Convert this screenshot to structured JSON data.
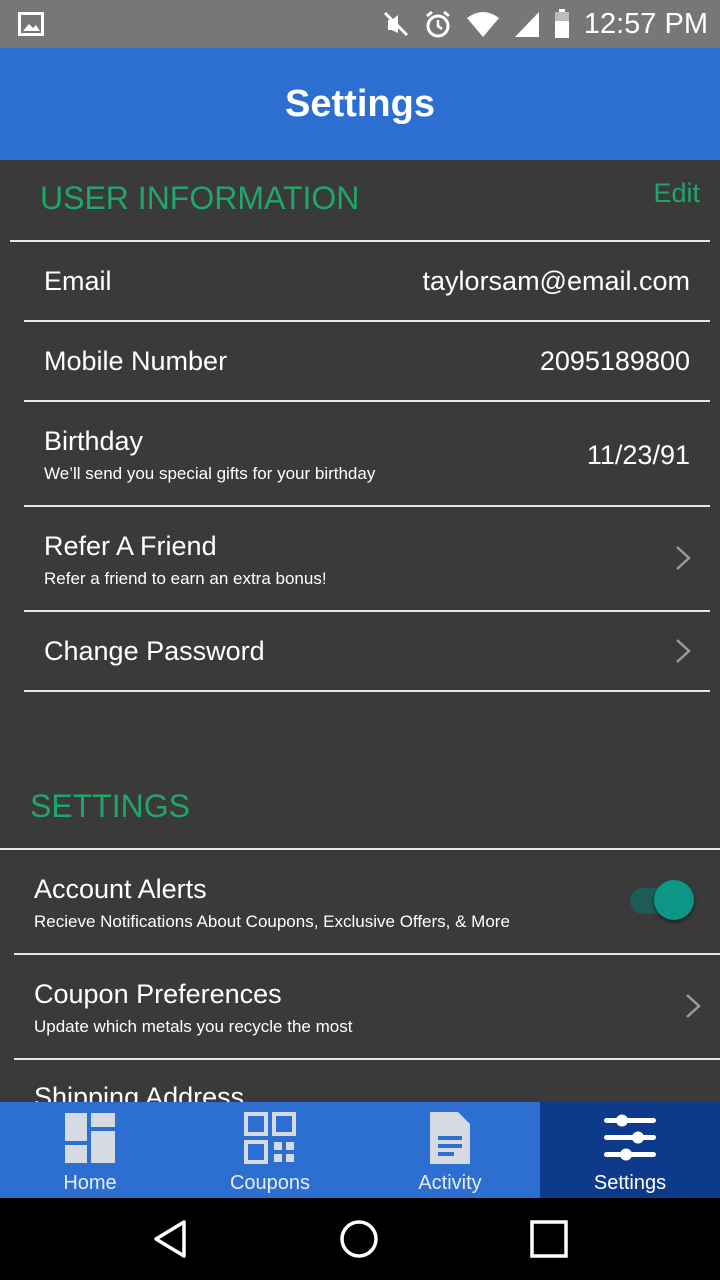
{
  "status_bar": {
    "time": "12:57 PM",
    "icons": [
      "image-icon",
      "mute-icon",
      "alarm-icon",
      "wifi-icon",
      "signal-icon",
      "battery-icon"
    ]
  },
  "app_bar": {
    "title": "Settings"
  },
  "user_info": {
    "header": "USER INFORMATION",
    "edit_label": "Edit",
    "rows": [
      {
        "label": "Email",
        "value": "taylorsam@email.com"
      },
      {
        "label": "Mobile Number",
        "value": "2095189800"
      },
      {
        "label": "Birthday",
        "sub": "We’ll send you special gifts for your birthday",
        "value": "11/23/91"
      },
      {
        "label": "Refer A Friend",
        "sub": "Refer a friend to earn an extra bonus!"
      },
      {
        "label": "Change Password"
      }
    ]
  },
  "settings": {
    "header": "SETTINGS",
    "rows": [
      {
        "label": "Account Alerts",
        "sub": "Recieve Notifications About Coupons, Exclusive Offers, & More",
        "toggle_on": true
      },
      {
        "label": "Coupon Preferences",
        "sub": "Update which metals you recycle the most"
      },
      {
        "label": "Shipping Address"
      }
    ]
  },
  "bottom_nav": {
    "items": [
      {
        "label": "Home",
        "icon": "dashboard-icon"
      },
      {
        "label": "Coupons",
        "icon": "qr-code-icon"
      },
      {
        "label": "Activity",
        "icon": "document-icon"
      },
      {
        "label": "Settings",
        "icon": "sliders-icon",
        "active": true
      }
    ]
  },
  "colors": {
    "accent_green": "#1fa66a",
    "app_bar_blue": "#2d6fd0",
    "nav_active": "#0d3a8a",
    "background": "#3a3a3a",
    "toggle_teal": "#0d9685"
  }
}
